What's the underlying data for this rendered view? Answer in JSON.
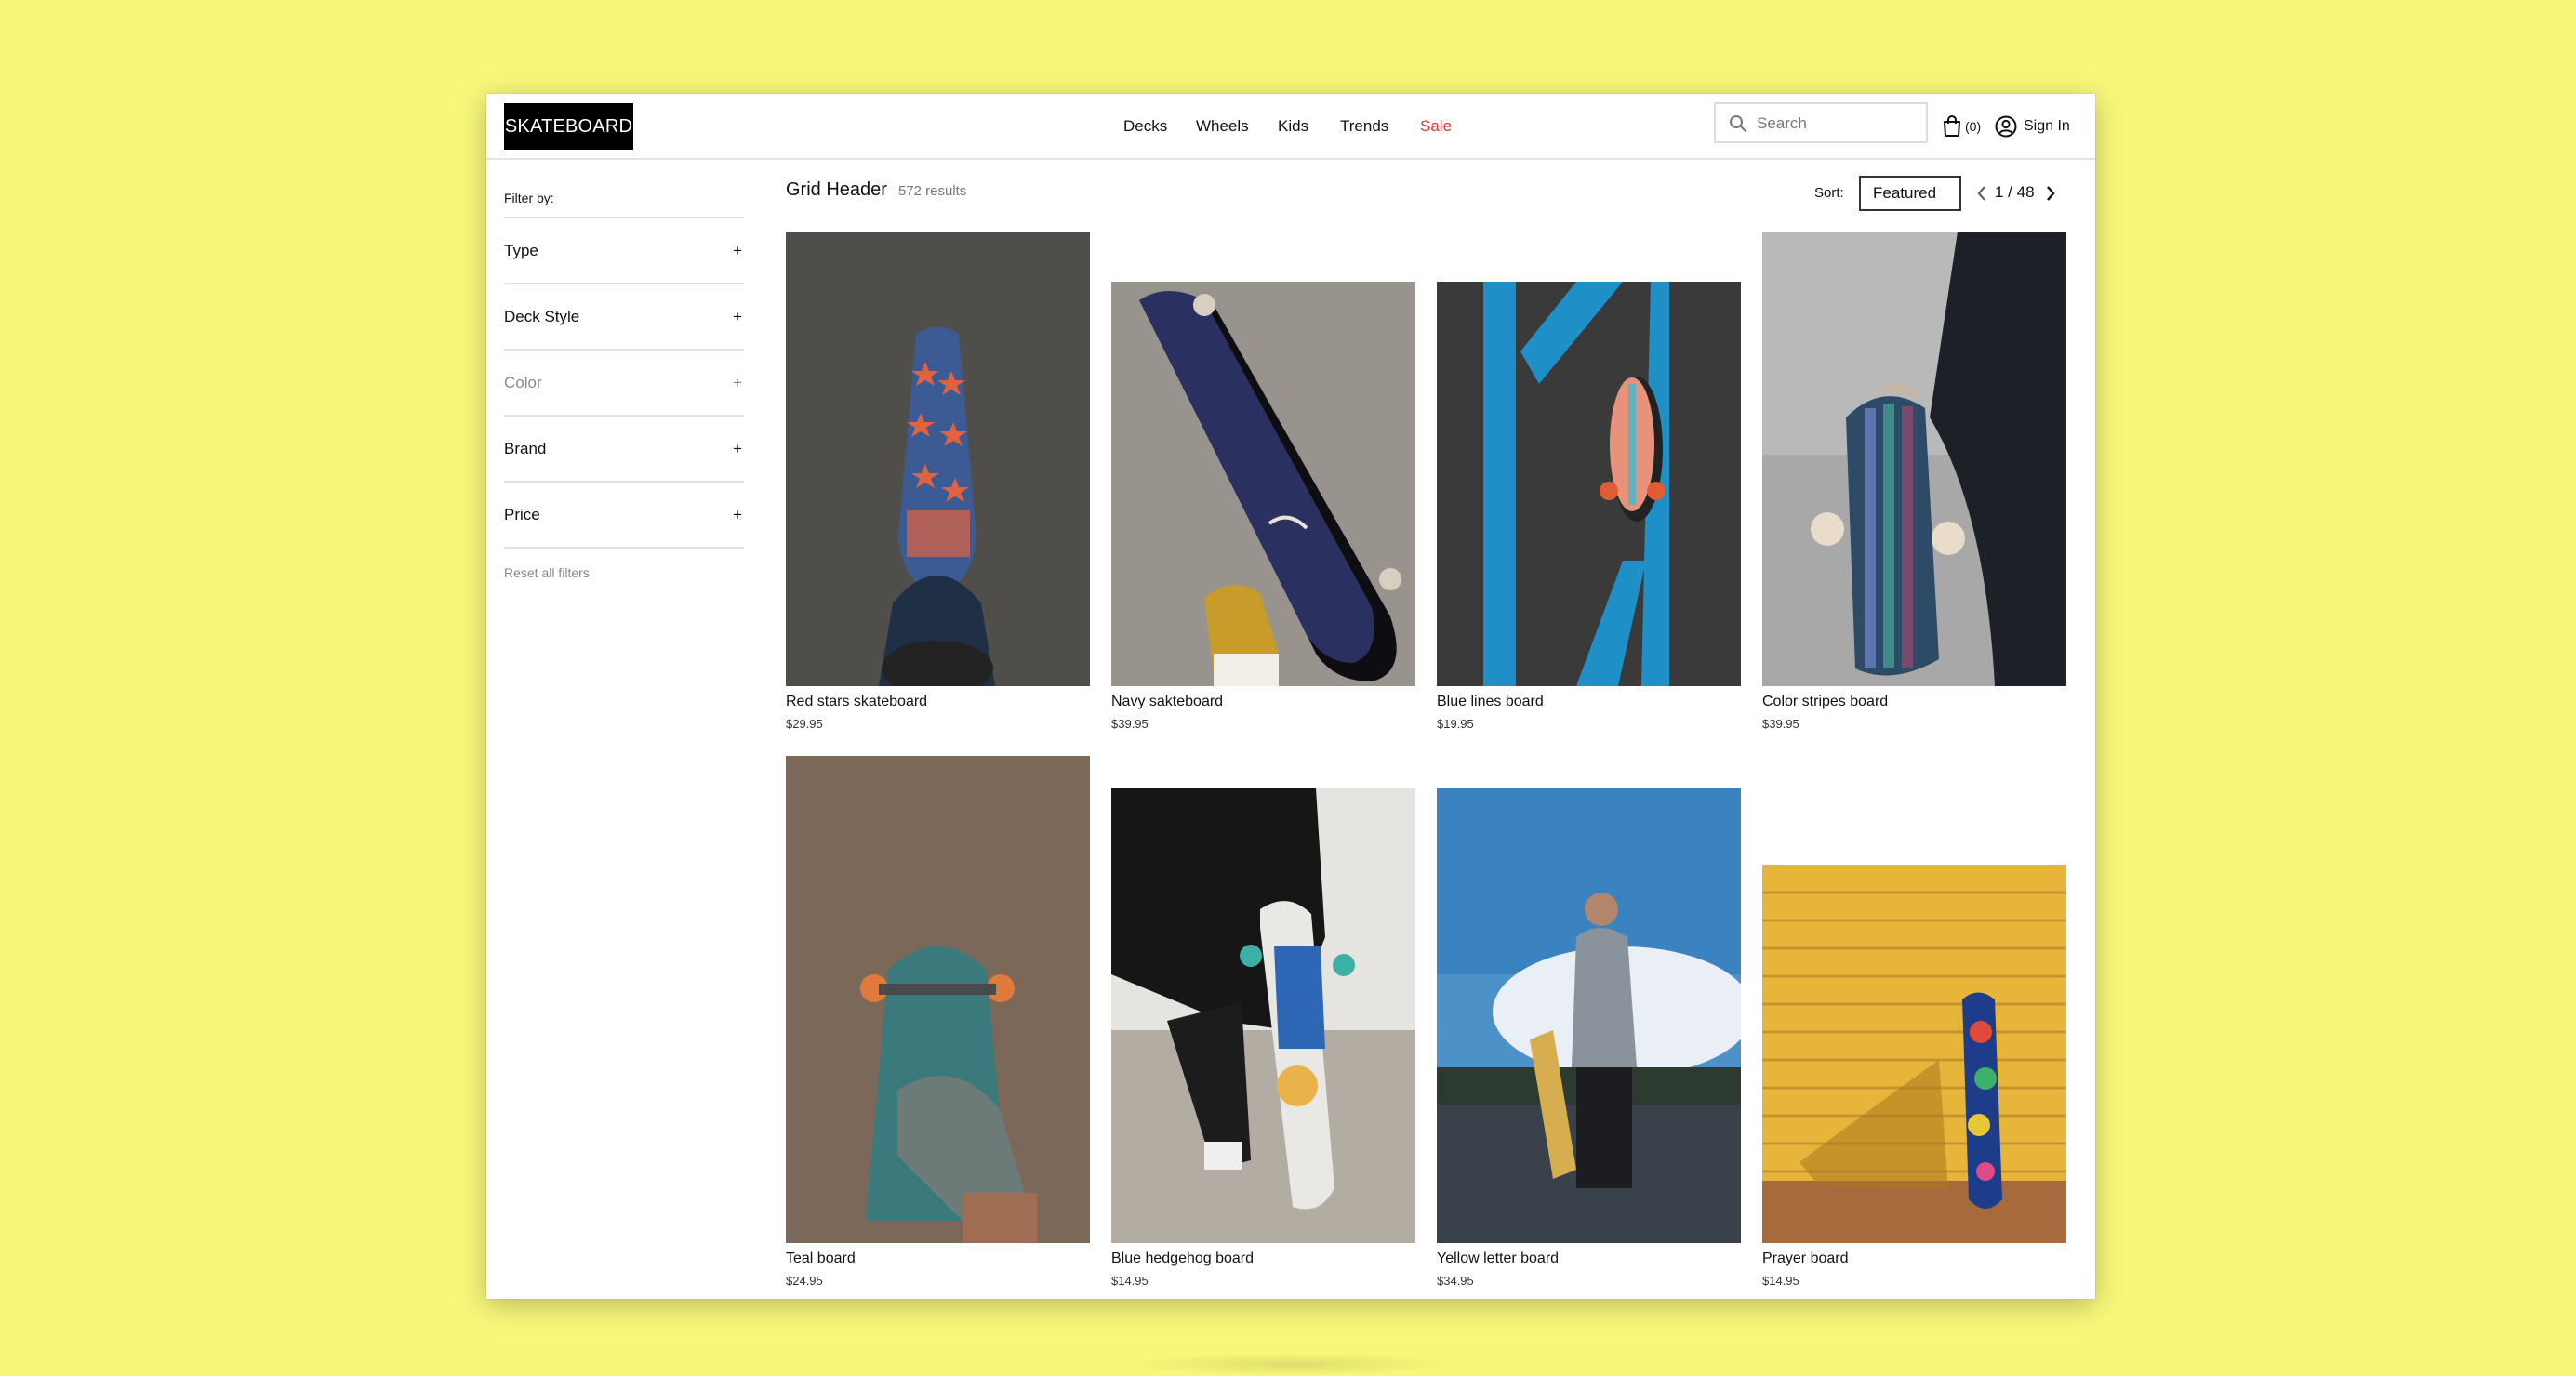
{
  "header": {
    "logo": "SKATEBOARD",
    "nav": [
      "Decks",
      "Wheels",
      "Kids",
      "Trends",
      "Sale"
    ],
    "search_placeholder": "Search",
    "cart_count": "(0)",
    "signin_label": "Sign In",
    "sale_color": "#e8332a"
  },
  "sidebar": {
    "title": "Filter by:",
    "filters": [
      "Type",
      "Deck Style",
      "Color",
      "Brand",
      "Price"
    ],
    "reset_label": "Reset all filters"
  },
  "grid": {
    "title": "Grid Header",
    "results": "572 results",
    "sort_label": "Sort:",
    "sort_value": "Featured",
    "pager": "1 / 48"
  },
  "products": [
    {
      "name": "Red stars skateboard",
      "price": "$29.95"
    },
    {
      "name": "Navy sakteboard",
      "price": "$39.95"
    },
    {
      "name": "Blue lines board",
      "price": "$19.95"
    },
    {
      "name": "Color stripes board",
      "price": "$39.95"
    },
    {
      "name": "Teal board",
      "price": "$24.95"
    },
    {
      "name": "Blue hedgehog board",
      "price": "$14.95"
    },
    {
      "name": "Yellow letter board",
      "price": "$34.95"
    },
    {
      "name": "Prayer board",
      "price": "$14.95"
    }
  ],
  "colors": {
    "background": "#f8f77a",
    "logo_bg": "#000000",
    "accent_sale": "#e8332a"
  }
}
